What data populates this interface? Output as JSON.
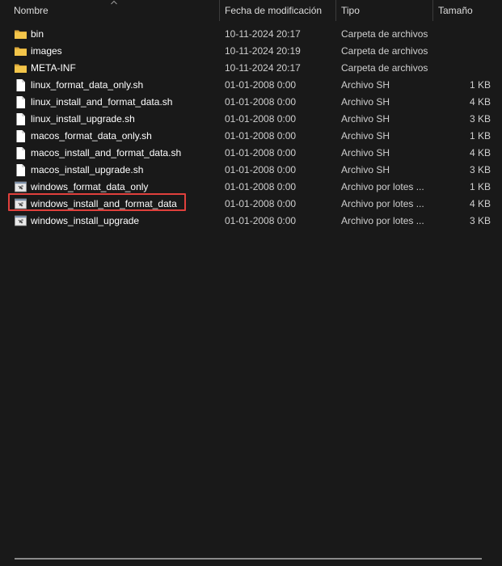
{
  "columns": {
    "name": "Nombre",
    "date": "Fecha de modificación",
    "type": "Tipo",
    "size": "Tamaño"
  },
  "files": [
    {
      "name": "bin",
      "date": "10-11-2024 20:17",
      "type": "Carpeta de archivos",
      "size": "",
      "icon": "folder-icon"
    },
    {
      "name": "images",
      "date": "10-11-2024 20:19",
      "type": "Carpeta de archivos",
      "size": "",
      "icon": "folder-icon"
    },
    {
      "name": "META-INF",
      "date": "10-11-2024 20:17",
      "type": "Carpeta de archivos",
      "size": "",
      "icon": "folder-icon"
    },
    {
      "name": "linux_format_data_only.sh",
      "date": "01-01-2008 0:00",
      "type": "Archivo SH",
      "size": "1 KB",
      "icon": "file-icon"
    },
    {
      "name": "linux_install_and_format_data.sh",
      "date": "01-01-2008 0:00",
      "type": "Archivo SH",
      "size": "4 KB",
      "icon": "file-icon"
    },
    {
      "name": "linux_install_upgrade.sh",
      "date": "01-01-2008 0:00",
      "type": "Archivo SH",
      "size": "3 KB",
      "icon": "file-icon"
    },
    {
      "name": "macos_format_data_only.sh",
      "date": "01-01-2008 0:00",
      "type": "Archivo SH",
      "size": "1 KB",
      "icon": "file-icon"
    },
    {
      "name": "macos_install_and_format_data.sh",
      "date": "01-01-2008 0:00",
      "type": "Archivo SH",
      "size": "4 KB",
      "icon": "file-icon"
    },
    {
      "name": "macos_install_upgrade.sh",
      "date": "01-01-2008 0:00",
      "type": "Archivo SH",
      "size": "3 KB",
      "icon": "file-icon"
    },
    {
      "name": "windows_format_data_only",
      "date": "01-01-2008 0:00",
      "type": "Archivo por lotes ...",
      "size": "1 KB",
      "icon": "batch-file-icon"
    },
    {
      "name": "windows_install_and_format_data",
      "date": "01-01-2008 0:00",
      "type": "Archivo por lotes ...",
      "size": "4 KB",
      "icon": "batch-file-icon",
      "highlighted": true
    },
    {
      "name": "windows_install_upgrade",
      "date": "01-01-2008 0:00",
      "type": "Archivo por lotes ...",
      "size": "3 KB",
      "icon": "batch-file-icon"
    }
  ],
  "colors": {
    "background": "#191919",
    "folder": "#f3c54a",
    "highlight_border": "#e0403c"
  }
}
